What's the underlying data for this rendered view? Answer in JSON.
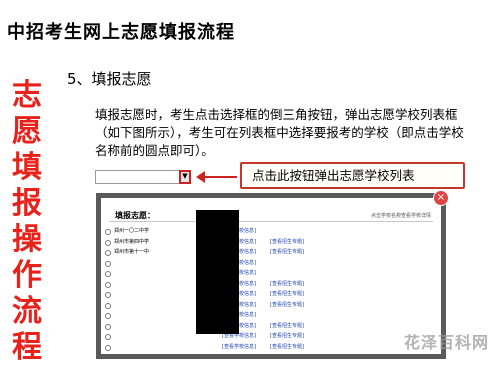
{
  "page_title": "中招考生网上志愿填报流程",
  "side_title": [
    "志",
    "愿",
    "填",
    "报",
    "操",
    "作",
    "流",
    "程"
  ],
  "step_heading": "5、填报志愿",
  "instruction": "填报志愿时，考生点击选择框的倒三角按钮，弹出志愿学校列表框（如下图所示），考生可在列表框中选择要报考的学校（即点击学校名称前的圆点即可）。",
  "dropdown": {
    "selected": "",
    "arrow": "▼"
  },
  "callout_text": "点击此按钮弹出志愿学校列表",
  "colors": {
    "side_title": "#e8221b",
    "callout_border": "#c0392b",
    "link": "#1a3fb4",
    "watermark": "#9a9a9a"
  },
  "popup": {
    "heading": "填报志愿：",
    "hint": "点击学校名称查看学校详情",
    "close_icon": "×",
    "rows": [
      {
        "school": "郑州一〇二中学",
        "link1": "[查看学校信息]",
        "link2": ""
      },
      {
        "school": "郑州市第四中学",
        "link1": "[查看学校信息]",
        "link2": "[查看招生专题]"
      },
      {
        "school": "郑州市第十一中",
        "link1": "[查看学校信息]",
        "link2": "[查看招生专题]"
      },
      {
        "school": "",
        "link1": "[查看学校信息]",
        "link2": ""
      },
      {
        "school": "",
        "link1": "[查看学校信息]",
        "link2": ""
      },
      {
        "school": "",
        "link1": "[查看学校信息]",
        "link2": "[查看招生专题]"
      },
      {
        "school": "",
        "link1": "[查看学校信息]",
        "link2": "[查看招生专题]"
      },
      {
        "school": "",
        "link1": "[查看学校信息]",
        "link2": "[查看招生专题]"
      },
      {
        "school": "",
        "link1": "[查看学校信息]",
        "link2": ""
      },
      {
        "school": "",
        "link1": "[查看学校信息]",
        "link2": "[查看招生专题]"
      },
      {
        "school": "",
        "link1": "[查看学校信息]",
        "link2": "[查看招生专题]"
      },
      {
        "school": "",
        "link1": "[查看学校信息]",
        "link2": "[查看招生专题]"
      }
    ]
  },
  "watermark": "花泽百科网"
}
